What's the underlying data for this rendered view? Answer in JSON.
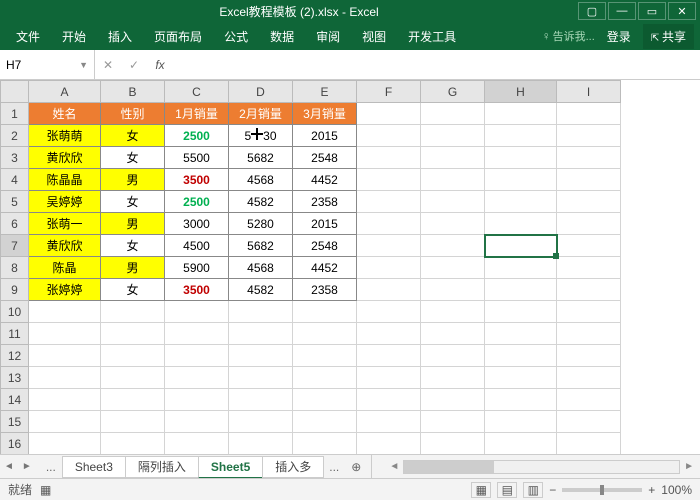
{
  "titlebar": {
    "title": "Excel教程模板 (2).xlsx - Excel"
  },
  "ribbon": {
    "tabs": [
      "文件",
      "开始",
      "插入",
      "页面布局",
      "公式",
      "数据",
      "审阅",
      "视图",
      "开发工具"
    ],
    "tell": "告诉我...",
    "login": "登录",
    "share": "共享"
  },
  "namebox": "H7",
  "columns": [
    "A",
    "B",
    "C",
    "D",
    "E",
    "F",
    "G",
    "H",
    "I"
  ],
  "headers": {
    "A": "姓名",
    "B": "性别",
    "C": "1月销量",
    "D": "2月销量",
    "E": "3月销量"
  },
  "rows": [
    {
      "n": "张萌萌",
      "g": "女",
      "c1": "2500",
      "c1c": "#00b050",
      "d": "5630",
      "e": "2015",
      "gbg": true,
      "cursor": true
    },
    {
      "n": "黄欣欣",
      "g": "女",
      "c1": "5500",
      "d": "5682",
      "e": "2548"
    },
    {
      "n": "陈晶晶",
      "g": "男",
      "c1": "3500",
      "c1c": "#c00000",
      "d": "4568",
      "e": "4452",
      "gbg": true
    },
    {
      "n": "吴婷婷",
      "g": "女",
      "c1": "2500",
      "c1c": "#00b050",
      "d": "4582",
      "e": "2358"
    },
    {
      "n": "张萌一",
      "g": "男",
      "c1": "3000",
      "d": "5280",
      "e": "2015",
      "gbg": true
    },
    {
      "n": "黄欣欣",
      "g": "女",
      "c1": "4500",
      "d": "5682",
      "e": "2548"
    },
    {
      "n": "陈晶",
      "g": "男",
      "c1": "5900",
      "d": "4568",
      "e": "4452",
      "gbg": true
    },
    {
      "n": "张婷婷",
      "g": "女",
      "c1": "3500",
      "c1c": "#c00000",
      "d": "4582",
      "e": "2358"
    }
  ],
  "emptyRows": 8,
  "sheetTabs": {
    "tabs": [
      "Sheet3",
      "隔列插入",
      "Sheet5",
      "插入多"
    ],
    "active": "Sheet5",
    "more": "..."
  },
  "status": {
    "left": "就绪",
    "zoom": "100%"
  },
  "selectedCell": {
    "row": 7,
    "col": "H"
  }
}
